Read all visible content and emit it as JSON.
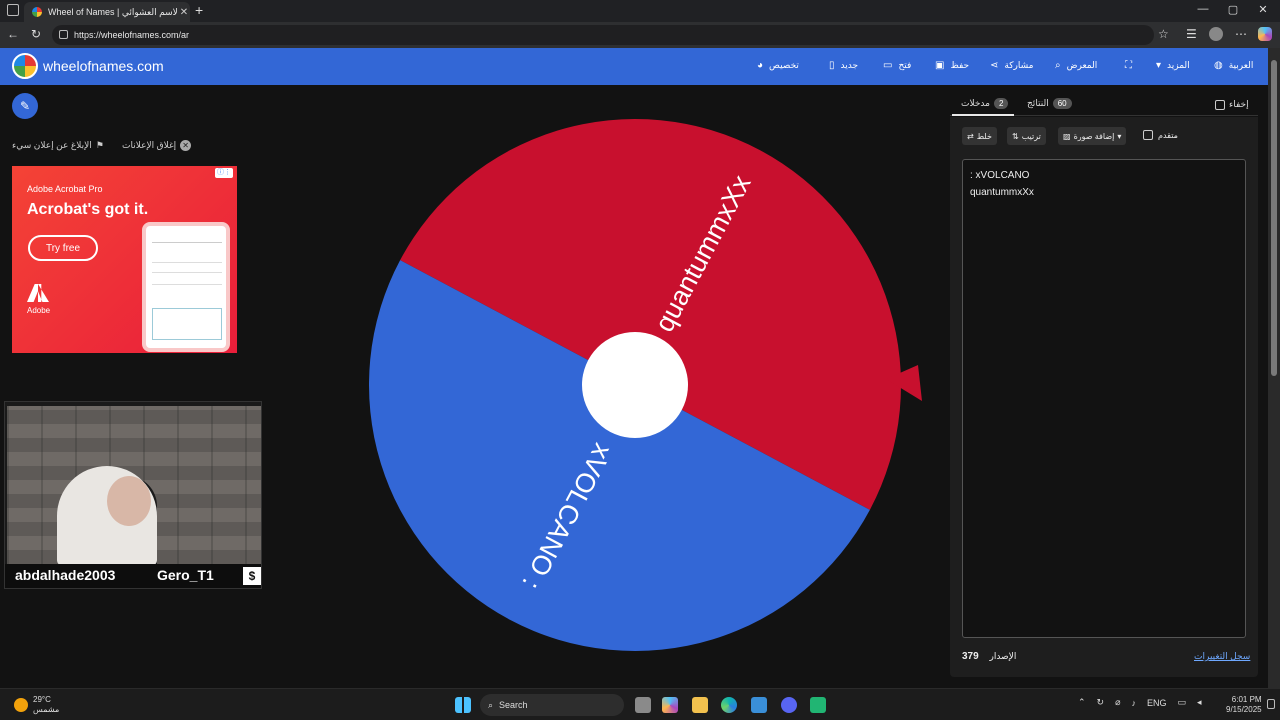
{
  "browser": {
    "tab_title": "Wheel of Names | الاسم العشوائي",
    "tab_close": "✕",
    "new_tab": "+",
    "url": "https://wheelofnames.com/ar",
    "window_controls": [
      "—",
      "▢",
      "✕"
    ]
  },
  "header": {
    "site_name": "wheelofnames.com",
    "nav": {
      "customize": "تخصيص",
      "new": "جديد",
      "open": "فتح",
      "save": "حفظ",
      "share": "مشاركة",
      "gallery": "المعرض",
      "more": "المزيد",
      "language": "العربية"
    }
  },
  "ads": {
    "close_ads": "إغلاق الإعلانات",
    "report_ad": "الإبلاغ عن إعلان سيء",
    "banner": {
      "subtitle": "Adobe Acrobat Pro",
      "headline": "Acrobat's got it.",
      "cta": "Try free",
      "brand": "Adobe"
    }
  },
  "webcam": {
    "name_left": "abdalhade2003",
    "name_right": "Gero_T1",
    "symbol": "$"
  },
  "wheel": {
    "segments": [
      {
        "label": "quantummxXx",
        "color": "#c8102e"
      },
      {
        "label": "xVOLCANO :",
        "color": "#3367d6"
      }
    ],
    "pointer_color": "#c8102e"
  },
  "panel": {
    "hide_label": "إخفاء",
    "tabs": {
      "entries_label": "مدخلات",
      "entries_count": "2",
      "results_label": "النتائج",
      "results_count": "60"
    },
    "toolbar": {
      "shuffle": "خلط",
      "sort": "ترتيب",
      "add_image": "إضافة صورة",
      "advanced": "متقدم"
    },
    "entries": [
      ": xVOLCANO",
      "quantummxXx"
    ],
    "version_label": "الإصدار",
    "version_number": "379",
    "changelog": "سجل التغييرات"
  },
  "taskbar": {
    "temperature": "29°C",
    "weather_desc": "مشمس",
    "search_placeholder": "Search",
    "language": "ENG",
    "time": "6:01 PM",
    "date": "9/15/2025"
  }
}
